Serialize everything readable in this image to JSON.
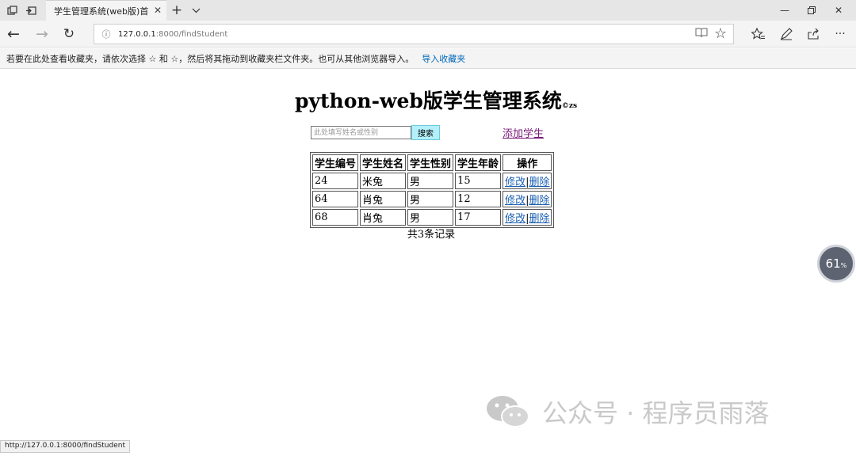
{
  "browser": {
    "tab_title": "学生管理系统(web版)首",
    "url_host": "127.0.0.1",
    "url_path": ":8000/findStudent",
    "favorites_hint": "若要在此处查看收藏夹，请依次选择 ☆ 和 ☆，然后将其拖动到收藏夹栏文件夹。也可从其他浏览器导入。",
    "import_favorites": "导入收藏夹",
    "status_url": "http://127.0.0.1:8000/findStudent"
  },
  "page": {
    "title": "python-web版学生管理系统",
    "copyright": "©zs",
    "search": {
      "placeholder": "此处填写姓名或性别",
      "button": "搜索"
    },
    "add_student": "添加学生",
    "table": {
      "headers": [
        "学生编号",
        "学生姓名",
        "学生性别",
        "学生年龄",
        "操作"
      ],
      "rows": [
        {
          "id": "24",
          "name": "米兔",
          "gender": "男",
          "age": "15"
        },
        {
          "id": "64",
          "name": "肖兔",
          "gender": "男",
          "age": "12"
        },
        {
          "id": "68",
          "name": "肖兔",
          "gender": "男",
          "age": "17"
        }
      ],
      "edit_label": "修改",
      "delete_label": "删除"
    },
    "total": "共3条记录"
  },
  "overlay": {
    "gauge_value": "61",
    "gauge_unit": "%",
    "watermark": "公众号 · 程序员雨落"
  },
  "icons": {
    "tab_actions": "tab-actions-icon",
    "set_aside_tabs": "set-aside-tabs-icon",
    "new_tab": "plus-icon",
    "tab_list": "chevron-down-icon",
    "back": "arrow-left-icon",
    "forward": "arrow-right-icon",
    "refresh": "refresh-icon",
    "reading_view": "book-icon",
    "favorite": "star-icon",
    "favorites_hub": "star-list-icon",
    "notes": "pen-icon",
    "share": "share-icon",
    "more": "more-icon"
  }
}
